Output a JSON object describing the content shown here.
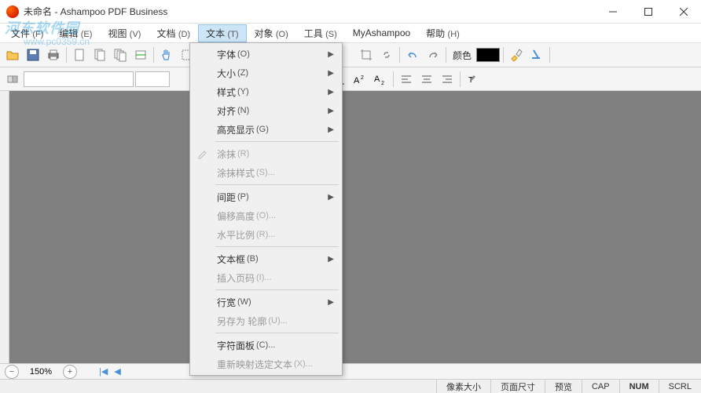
{
  "window": {
    "title": "未命名 - Ashampoo PDF Business"
  },
  "watermark": {
    "line1": "河东软件园",
    "line2": "www.pc0359.cn"
  },
  "menubar": [
    {
      "label": "文件",
      "accel": "(F)"
    },
    {
      "label": "编辑",
      "accel": "(E)"
    },
    {
      "label": "视图",
      "accel": "(V)"
    },
    {
      "label": "文档",
      "accel": "(D)"
    },
    {
      "label": "文本",
      "accel": "(T)"
    },
    {
      "label": "对象",
      "accel": "(O)"
    },
    {
      "label": "工具",
      "accel": "(S)"
    },
    {
      "label": "MyAshampoo",
      "accel": ""
    },
    {
      "label": "帮助",
      "accel": "(H)"
    }
  ],
  "dropdown": {
    "items": [
      {
        "label": "字体",
        "accel": "(O)",
        "sub": true,
        "enabled": true
      },
      {
        "label": "大小",
        "accel": "(Z)",
        "sub": true,
        "enabled": true
      },
      {
        "label": "样式",
        "accel": "(Y)",
        "sub": true,
        "enabled": true
      },
      {
        "label": "对齐",
        "accel": "(N)",
        "sub": true,
        "enabled": true
      },
      {
        "label": "高亮显示",
        "accel": "(G)",
        "sub": true,
        "enabled": true
      },
      {
        "sep": true
      },
      {
        "label": "涂抹",
        "accel": "(R)",
        "sub": false,
        "enabled": false,
        "icon": "pencil"
      },
      {
        "label": "涂抹样式",
        "accel": "(S)...",
        "sub": false,
        "enabled": false
      },
      {
        "sep": true
      },
      {
        "label": "间距",
        "accel": "(P)",
        "sub": true,
        "enabled": true
      },
      {
        "label": "偏移高度",
        "accel": "(O)...",
        "sub": false,
        "enabled": false
      },
      {
        "label": "水平比例",
        "accel": "(R)...",
        "sub": false,
        "enabled": false
      },
      {
        "sep": true
      },
      {
        "label": "文本框",
        "accel": "(B)",
        "sub": true,
        "enabled": true
      },
      {
        "label": "插入页码",
        "accel": "(I)...",
        "sub": false,
        "enabled": false
      },
      {
        "sep": true
      },
      {
        "label": "行宽",
        "accel": "(W)",
        "sub": true,
        "enabled": true
      },
      {
        "label": "另存为 轮廓",
        "accel": "(U)...",
        "sub": false,
        "enabled": false
      },
      {
        "sep": true
      },
      {
        "label": "字符面板",
        "accel": "(C)...",
        "sub": false,
        "enabled": true
      },
      {
        "label": "重新映射选定文本",
        "accel": "(X)...",
        "sub": false,
        "enabled": false
      }
    ]
  },
  "toolbar2": {
    "color_label": "颜色"
  },
  "zoom": {
    "value": "150%"
  },
  "statusbar": {
    "pixel_size": "像素大小",
    "page_size": "页面尺寸",
    "preview": "预览",
    "cap": "CAP",
    "num": "NUM",
    "scrl": "SCRL"
  }
}
